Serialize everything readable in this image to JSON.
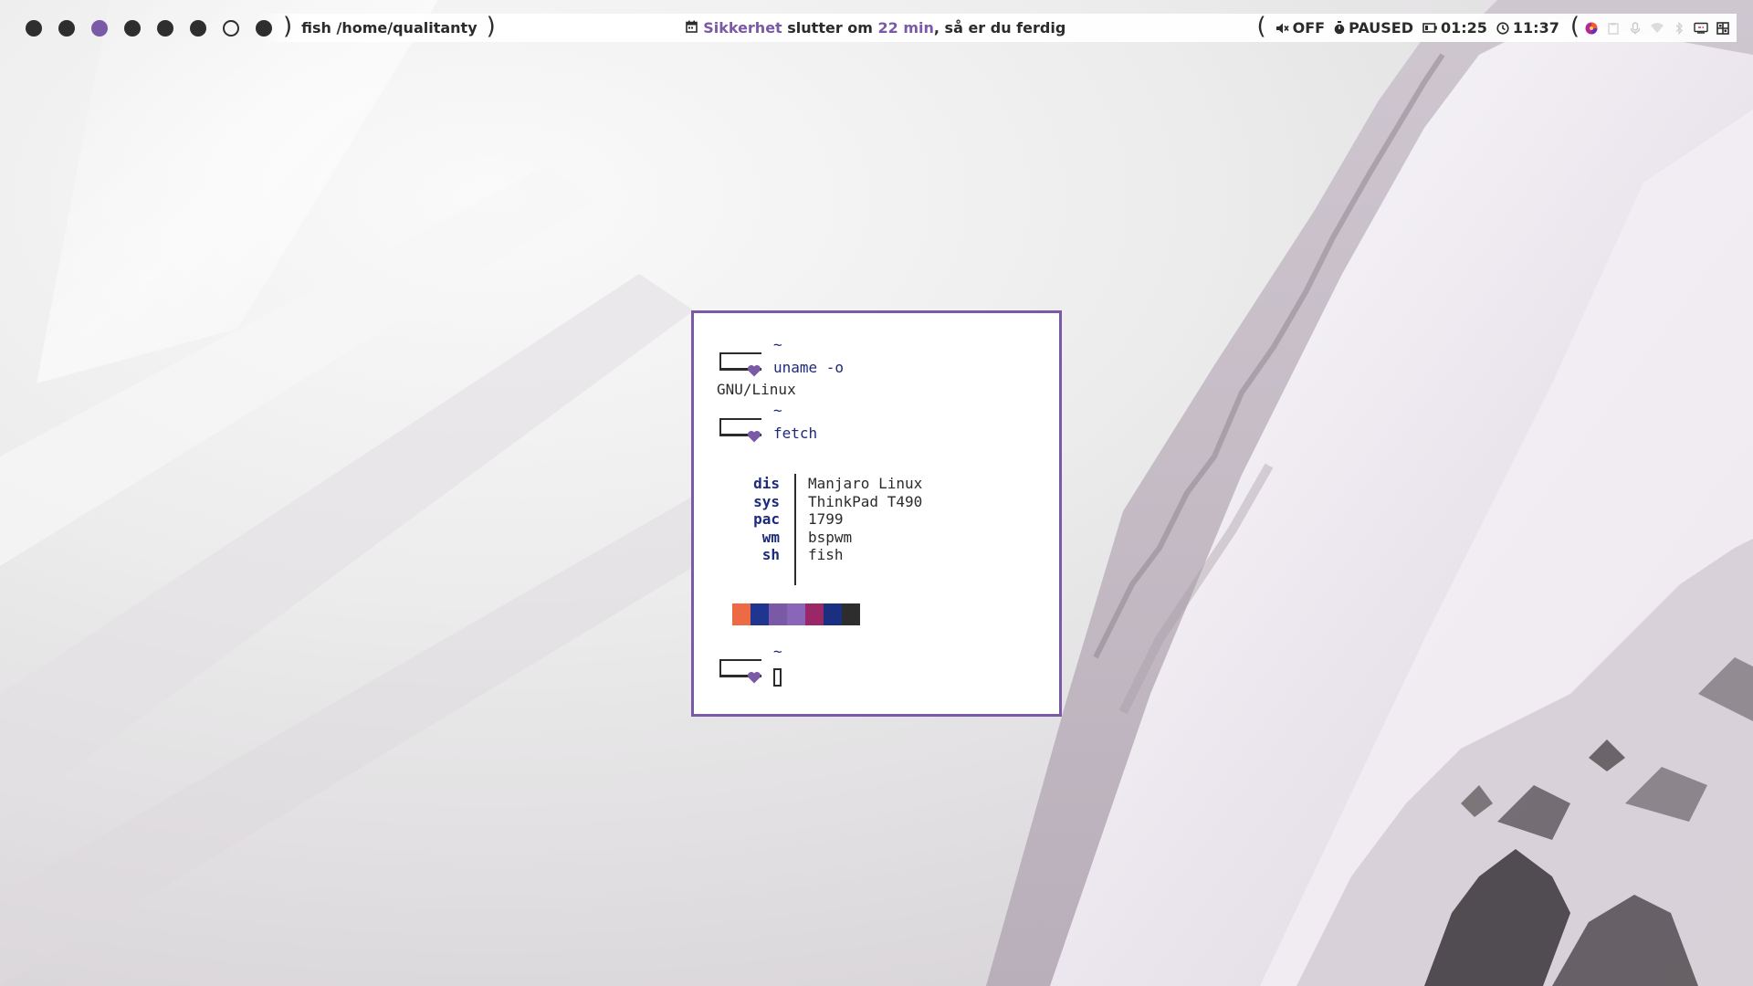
{
  "bar": {
    "workspaces": [
      {
        "state": "occupied"
      },
      {
        "state": "occupied"
      },
      {
        "state": "active"
      },
      {
        "state": "occupied"
      },
      {
        "state": "occupied"
      },
      {
        "state": "occupied"
      },
      {
        "state": "empty"
      },
      {
        "state": "occupied"
      }
    ],
    "window_title": "fish /home/qualitanty",
    "notification": {
      "task": "Sikkerhet",
      "middle": " slutter om ",
      "remaining": "22 min",
      "tail": ", så er du ferdig"
    },
    "volume": "OFF",
    "timer": "PAUSED",
    "battery": "01:25",
    "clock": "11:37"
  },
  "terminal": {
    "home": "~",
    "cmd1": "uname -o",
    "output1": "GNU/Linux",
    "cmd2": "fetch",
    "info": [
      {
        "key": "dis",
        "value": "Manjaro Linux"
      },
      {
        "key": "sys",
        "value": "ThinkPad T490"
      },
      {
        "key": "pac",
        "value": "1799"
      },
      {
        "key": "wm",
        "value": "bspwm"
      },
      {
        "key": "sh",
        "value": "fish"
      }
    ],
    "palette": [
      "#ec6b45",
      "#203590",
      "#7a5aa6",
      "#8a66b8",
      "#9a2868",
      "#1a2f80",
      "#2d2d2d"
    ]
  },
  "colors": {
    "accent": "#7a5aa6",
    "navy": "#1e2a7a",
    "bar_bg": "#ffffff",
    "dark": "#2b2b2b"
  },
  "icons": {
    "calendar": "calendar-icon",
    "volume": "speaker-muted-icon",
    "timer": "stopwatch-icon",
    "battery": "battery-icon",
    "clock": "clock-icon",
    "prompt": "heart-icon",
    "tray": [
      "color-wheel-icon",
      "clipboard-icon",
      "mic-icon",
      "wifi-icon",
      "bluetooth-icon",
      "display-icon",
      "grid-icon"
    ]
  }
}
